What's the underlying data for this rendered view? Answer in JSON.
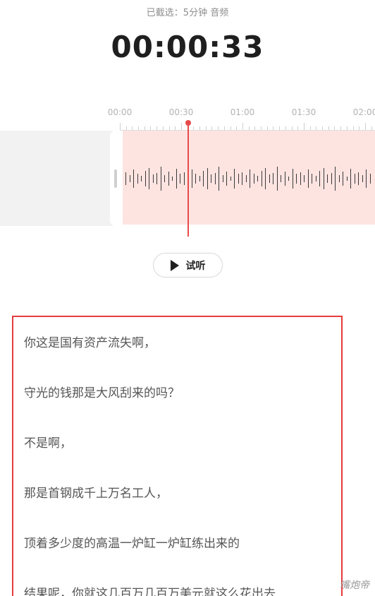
{
  "header": {
    "selected_info": "已截选：5分钟 音频",
    "current_time": "00:00:33"
  },
  "timeline": {
    "tick_labels": [
      "00:00",
      "00:30",
      "01:00",
      "01:30",
      "02:00"
    ]
  },
  "controls": {
    "preview_label": "试听"
  },
  "transcript": {
    "lines": [
      "你这是国有资产流失啊，",
      "守光的钱那是大风刮来的吗？",
      "不是啊，",
      "那是首钢成千上万名工人，",
      "顶着多少度的高温一炉缸一炉缸练出来的",
      "结果呢，你就这几百万几百万美元就这么花出去"
    ]
  },
  "watermark": "嘴炮帝",
  "colors": {
    "accent": "#e84a4a",
    "selection_fill": "#fde4e1",
    "highlight_border": "#e53c3c"
  }
}
